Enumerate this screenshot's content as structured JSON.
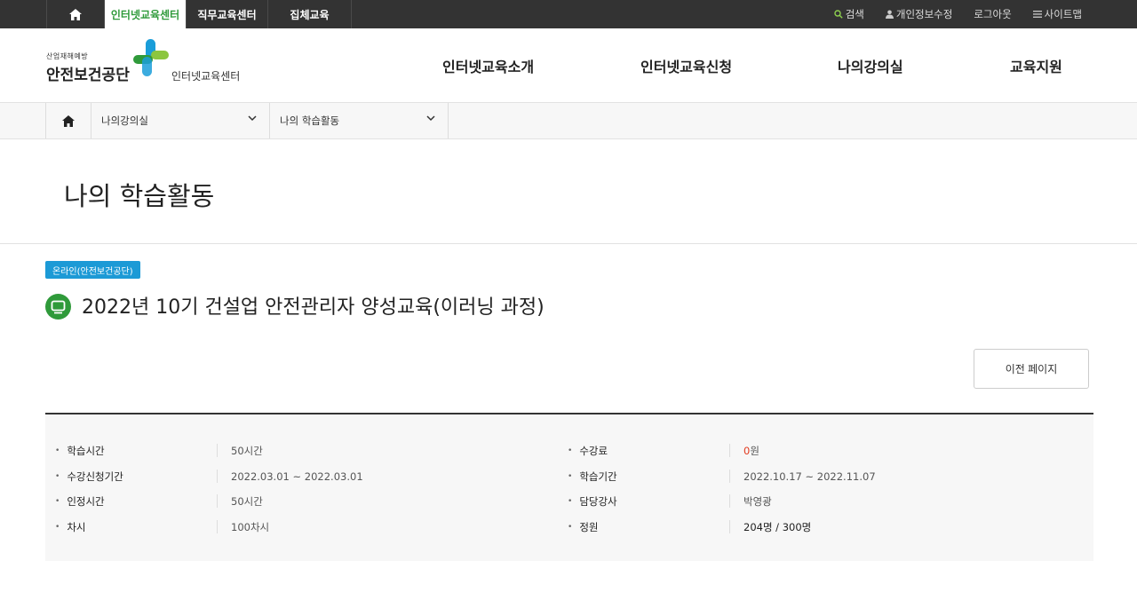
{
  "topbar": {
    "home_icon": "home-icon",
    "tabs": [
      "인터넷교육센터",
      "직무교육센터",
      "집체교육"
    ],
    "util": [
      "검색",
      "개인정보수정",
      "로그아웃",
      "사이트맵"
    ]
  },
  "logo": {
    "small": "산업재해예방",
    "big": "안전보건공단",
    "sub": "인터넷교육센터"
  },
  "gnb": [
    "인터넷교육소개",
    "인터넷교육신청",
    "나의강의실",
    "교육지원"
  ],
  "breadcrumb": {
    "home_icon": "home-icon",
    "level1": "나의강의실",
    "level2": "나의 학습활동"
  },
  "page_title": "나의 학습활동",
  "course": {
    "badge": "온라인(안전보건공단)",
    "title": "2022년 10기 건설업 안전관리자 양성교육(이러닝 과정)",
    "prev_button": "이전 페이지"
  },
  "info": {
    "study_time_label": "학습시간",
    "study_time": "50시간",
    "fee_label": "수강료",
    "fee_num": "0",
    "fee_unit": "원",
    "apply_period_label": "수강신청기간",
    "apply_period": "2022.03.01 ~ 2022.03.01",
    "study_period_label": "학습기간",
    "study_period": "2022.10.17 ~ 2022.11.07",
    "credit_time_label": "인정시간",
    "credit_time": "50시간",
    "instructor_label": "담당강사",
    "instructor": "박영광",
    "sessions_label": "차시",
    "sessions": "100차시",
    "capacity_label": "정원",
    "capacity": "204명 / 300명"
  },
  "colors": {
    "accent_green": "#2f9a3a",
    "badge_blue": "#1c9ad6",
    "topbar": "#333333",
    "fee_red": "#e23a1f"
  }
}
